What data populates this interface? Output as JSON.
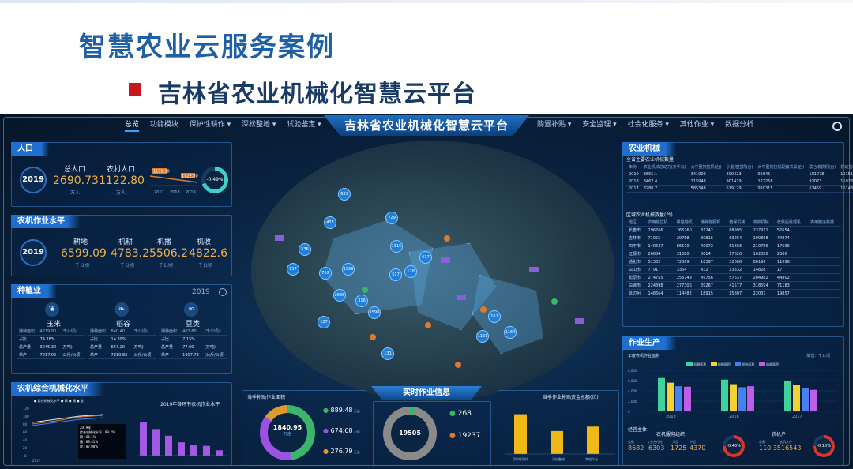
{
  "slide": {
    "title": "智慧农业云服务案例",
    "subtitle": "吉林省农业机械化智慧云平台"
  },
  "dashboard": {
    "title": "吉林省农业机械化智慧云平台",
    "nav_left": [
      "总览",
      "功能模块",
      "保护性耕作 ▾",
      "深松整地 ▾",
      "试验鉴定 ▾"
    ],
    "nav_right": [
      "购置补贴 ▾",
      "安全监理 ▾",
      "社会化服务 ▾",
      "其他作业 ▾",
      "数据分析"
    ]
  },
  "population": {
    "tag": "人口",
    "year": "2019",
    "total_label": "总人口",
    "total_value": "2690.73",
    "total_unit": "万人",
    "rural_label": "农村人口",
    "rural_value": "1122.80",
    "rural_unit": "万人",
    "change": "-0.49%",
    "mini_years": [
      "2017",
      "2018",
      "2019"
    ],
    "mini_labels": [
      "1170.98",
      "1122.80"
    ]
  },
  "mech_level": {
    "tag": "农机作业水平",
    "year": "2019",
    "items": [
      {
        "label": "耕地",
        "value": "6599.09",
        "unit": "千公顷"
      },
      {
        "label": "机耕",
        "value": "4783.2",
        "unit": "千公顷"
      },
      {
        "label": "机播",
        "value": "5506.2",
        "unit": "千公顷"
      },
      {
        "label": "机收",
        "value": "4822.6",
        "unit": "千公顷"
      }
    ]
  },
  "planting": {
    "tag": "种植业",
    "year": "2019",
    "crops": [
      {
        "name": "玉米",
        "rows": [
          [
            "播种面积",
            "4219.80",
            "(千公顷)"
          ],
          [
            "占比",
            "74.76%",
            ""
          ],
          [
            "总产量",
            "3045.30",
            "(万吨)"
          ],
          [
            "单产",
            "7217.02",
            "(公斤/公顷)"
          ]
        ]
      },
      {
        "name": "稻谷",
        "rows": [
          [
            "播种面积",
            "840.40",
            "(千公顷)"
          ],
          [
            "占比",
            "14.89%",
            ""
          ],
          [
            "总产量",
            "657.20",
            "(万吨)"
          ],
          [
            "单产",
            "7819.82",
            "(公斤/公顷)"
          ]
        ]
      },
      {
        "name": "豆类",
        "rows": [
          [
            "播种面积",
            "403.80",
            "(千公顷)"
          ],
          [
            "占比",
            "7.15%",
            ""
          ],
          [
            "总产量",
            "77.00",
            "(万吨)"
          ],
          [
            "单产",
            "1907.78",
            "(公斤/公顷)"
          ]
        ]
      }
    ]
  },
  "mech_rate": {
    "tag": "农机综合机械化水平",
    "chart_title": "2019年各环节农机作业水平",
    "legend": [
      "综合机械化水平",
      "耕",
      "播",
      "收"
    ],
    "tooltip": [
      "2019年",
      "综合机械化水平 : 89.2%",
      "耕 : 86.1%",
      "播 : 89.41%",
      "收 : 87.08%"
    ],
    "y_ticks": [
      "120",
      "100",
      "80",
      "60",
      "40",
      "20",
      "0"
    ],
    "x_ticks": [
      "2017"
    ],
    "bars": [
      75,
      60,
      45,
      30,
      25,
      22,
      12
    ]
  },
  "area_panel": {
    "title": "当季补贴作业面积",
    "center_value": "1840.95",
    "center_unit": "万亩",
    "legend": [
      {
        "value": "889.48",
        "unit": "万亩",
        "color": "#3ab56a"
      },
      {
        "value": "674.68",
        "unit": "万亩",
        "color": "#9b52e0"
      },
      {
        "value": "276.79",
        "unit": "万亩",
        "color": "#e09a2a"
      }
    ]
  },
  "realtime": {
    "title": "实时作业信息",
    "center_value": "19505",
    "stats": [
      {
        "value": "268",
        "color": "#3ab56a"
      },
      {
        "value": "19237",
        "color": "#e07a2a"
      }
    ]
  },
  "subsidy": {
    "title": "当季作业补贴资金总额(亿)",
    "x": [
      "保护性耕作",
      "深松整地",
      "其他作业"
    ]
  },
  "machinery": {
    "tag": "农业机械",
    "table1_title": "全省主要农业机械数量",
    "table1": [
      [
        "年份",
        "农业机械总动力(万千瓦)",
        "大中型拖拉机(台)",
        "小型拖拉机(台)",
        "大中型拖拉机配套农具(台)",
        "联合收获机(台)",
        "机动插秧机(台)",
        "机动水稻收割机(台)"
      ],
      [
        "2019",
        "3655.1",
        "341000",
        "890423",
        "95845",
        "101078",
        "161512",
        "98574"
      ],
      [
        "2018",
        "3462.4",
        "315948",
        "901479",
        "122258",
        "91073",
        "159265",
        "90630"
      ],
      [
        "2017",
        "3280.7",
        "585348",
        "619129",
        "920315",
        "62459",
        "161430",
        "79643"
      ]
    ],
    "table2_title": "区域农业机械数量(台)",
    "table2": [
      [
        "地区",
        "农用拖拉机",
        "耕整地机",
        "播种施肥机",
        "植保机械",
        "收获机械",
        "收获后处理机",
        "农用搬运机械"
      ],
      [
        "长春市",
        "296766",
        "266260",
        "81242",
        "88995",
        "237911",
        "57654",
        ""
      ],
      [
        "吉林市",
        "71055",
        "29758",
        "39816",
        "63254",
        "199868",
        "44874",
        ""
      ],
      [
        "四平市",
        "140637",
        "86570",
        "40072",
        "61866",
        "210756",
        "17696",
        ""
      ],
      [
        "辽源市",
        "26684",
        "31580",
        "8014",
        "17620",
        "102086",
        "2366",
        ""
      ],
      [
        "通化市",
        "51362",
        "72369",
        "18397",
        "32666",
        "86196",
        "11096",
        ""
      ],
      [
        "白山市",
        "7791",
        "3354",
        "432",
        "13332",
        "14828",
        "17",
        ""
      ],
      [
        "松原市",
        "274755",
        "256749",
        "49756",
        "57637",
        "204982",
        "44802",
        ""
      ],
      [
        "白城市",
        "224898",
        "277306",
        "39267",
        "41577",
        "318594",
        "71183",
        ""
      ],
      [
        "延边州",
        "148664",
        "114482",
        "18915",
        "15807",
        "22037",
        "19857",
        ""
      ]
    ]
  },
  "production": {
    "tag": "作业生产",
    "chart_label": "年度农机作业面积",
    "unit_label": "单位：千公顷",
    "legend": [
      "机耕面积",
      "机播面积",
      "机收面积",
      "机收面积"
    ],
    "y_ticks": [
      "8,000",
      "6,000",
      "4,000",
      "2,000",
      "0"
    ],
    "org_label": "经营主体",
    "org_center": "农机服务组织",
    "org_items": [
      {
        "label": "总数",
        "value": "8682"
      },
      {
        "label": "专业合作社",
        "value": "6303"
      },
      {
        "label": "大型",
        "value": "1725"
      },
      {
        "label": "中型",
        "value": "4370"
      }
    ],
    "org_ring": "-0.43%",
    "house_label": "农机户",
    "house_items": [
      {
        "label": "总数",
        "value": "110.35"
      },
      {
        "label": "农机大户",
        "value": "16543"
      }
    ],
    "house_ring": "-0.16%"
  },
  "chart_data": [
    {
      "type": "bar",
      "title": "年度农机作业面积",
      "categories": [
        "2019",
        "2018",
        "2017"
      ],
      "series": [
        {
          "name": "机耕面积",
          "values": [
            6500,
            6200,
            5900
          ],
          "color": "#41d19b"
        },
        {
          "name": "机播面积",
          "values": [
            5600,
            5300,
            5100
          ],
          "color": "#f2d332"
        },
        {
          "name": "机收面积",
          "values": [
            4900,
            4700,
            4600
          ],
          "color": "#4a7ff0"
        },
        {
          "name": "机收面积",
          "values": [
            4800,
            4900,
            4200
          ],
          "color": "#c05de8"
        }
      ],
      "ylim": [
        0,
        8000
      ]
    },
    {
      "type": "bar",
      "title": "当季作业补贴资金总额(亿)",
      "categories": [
        "保护性耕作",
        "深松整地",
        "其他作业"
      ],
      "values": [
        4.5,
        2.6,
        3.1
      ],
      "ylim": [
        0,
        5
      ]
    }
  ]
}
